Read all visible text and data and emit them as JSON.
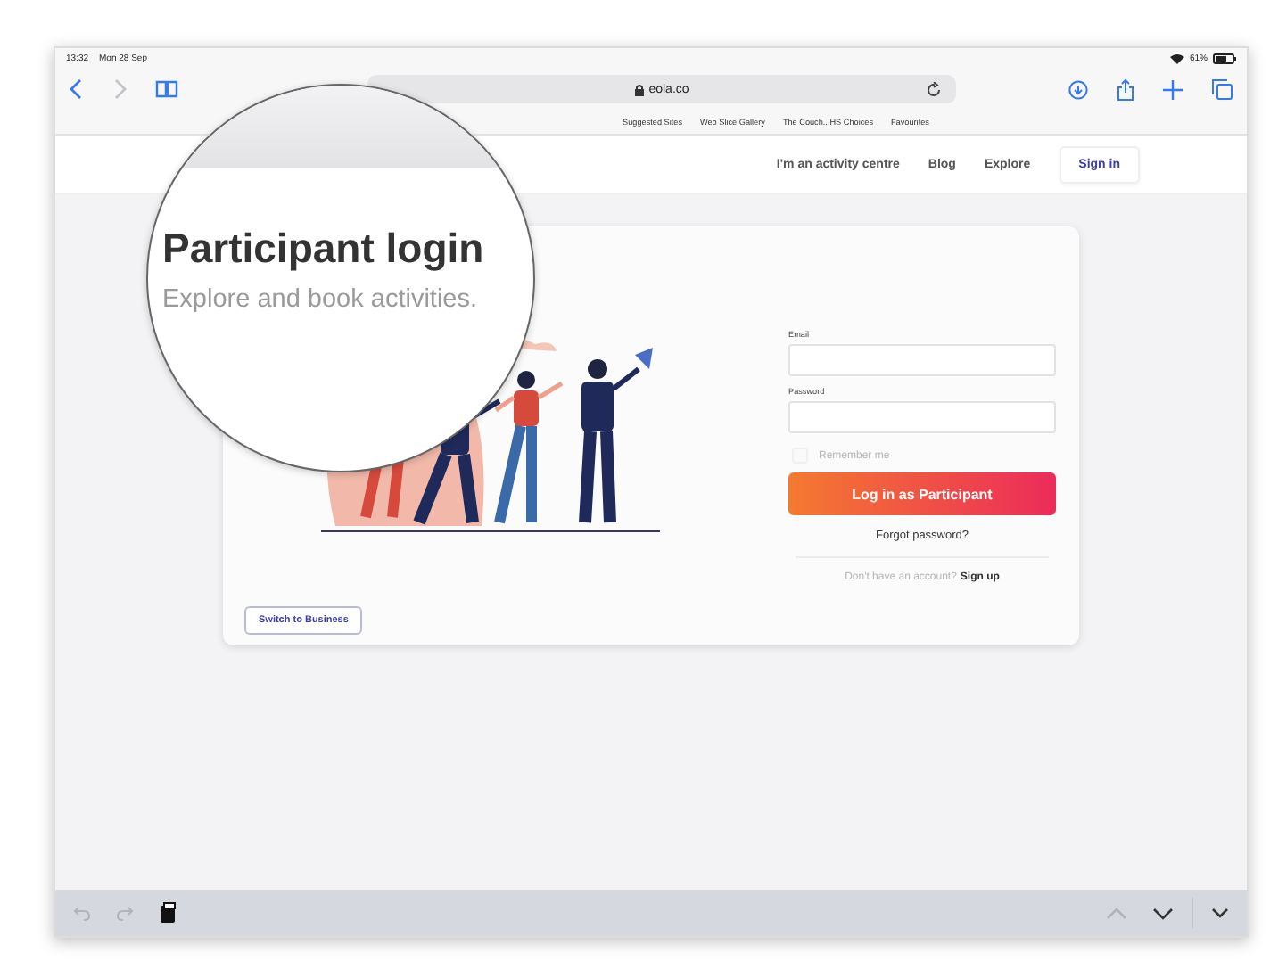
{
  "status_bar": {
    "time": "13:32",
    "date": "Mon 28 Sep",
    "battery": "61%"
  },
  "address_bar": {
    "url": "eola.co"
  },
  "bookmarks": [
    "Suggested Sites",
    "Web Slice Gallery",
    "The Couch...HS Choices",
    "Favourites"
  ],
  "site_nav": {
    "links": [
      "I'm an activity centre",
      "Blog",
      "Explore"
    ],
    "sign_in": "Sign in"
  },
  "magnifier": {
    "title": "Participant login",
    "subtitle": "Explore and book activities."
  },
  "login_form": {
    "fields": [
      {
        "label": "Email"
      },
      {
        "label": "Password"
      }
    ],
    "remember_me": {
      "label": "Remember me",
      "checked": false
    },
    "submit": "Log in as Participant",
    "forgot": "Forgot password?",
    "signup_prompt": "Don't have an account?",
    "signup_link": "Sign up"
  },
  "switch_button": "Switch to Business"
}
